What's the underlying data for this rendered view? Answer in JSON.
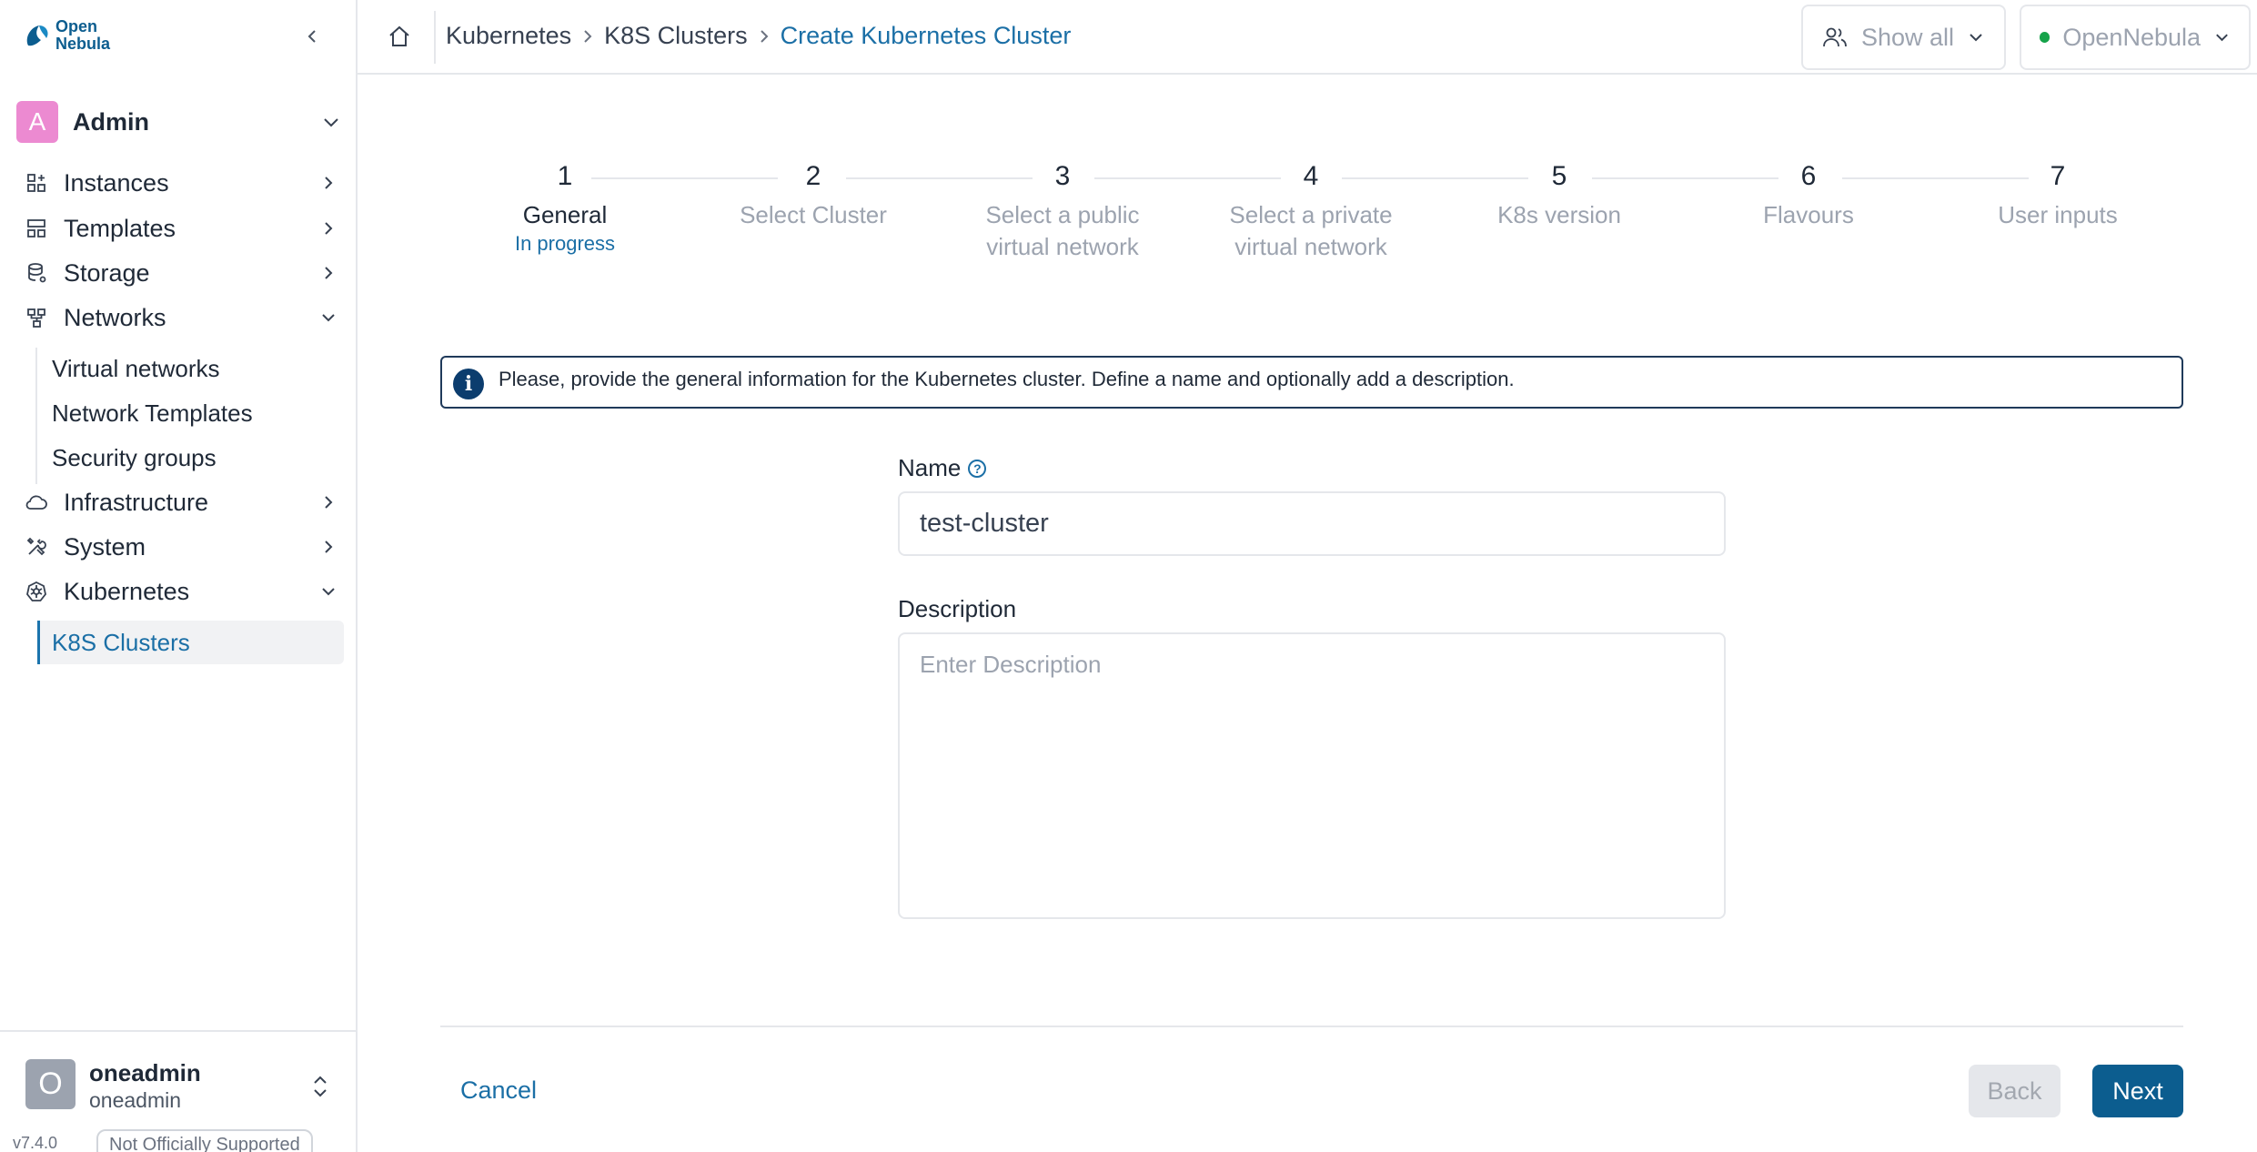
{
  "brand": {
    "logo_line1": "Open",
    "logo_line2": "Nebula",
    "accent": "#1b6fa6",
    "primary": "#0c5d8f"
  },
  "sidebar": {
    "group": {
      "avatar_letter": "A",
      "label": "Admin"
    },
    "items": [
      {
        "label": "Instances",
        "icon": "instances-icon",
        "expanded": false
      },
      {
        "label": "Templates",
        "icon": "templates-icon",
        "expanded": false
      },
      {
        "label": "Storage",
        "icon": "storage-icon",
        "expanded": false
      },
      {
        "label": "Networks",
        "icon": "networks-icon",
        "expanded": true,
        "children": [
          "Virtual networks",
          "Network Templates",
          "Security groups"
        ]
      },
      {
        "label": "Infrastructure",
        "icon": "cloud-icon",
        "expanded": false
      },
      {
        "label": "System",
        "icon": "tools-icon",
        "expanded": false
      },
      {
        "label": "Kubernetes",
        "icon": "kubernetes-icon",
        "expanded": true,
        "children": [
          "K8S Clusters"
        ]
      }
    ],
    "user": {
      "avatar_letter": "O",
      "name": "oneadmin",
      "group": "oneadmin"
    },
    "version": "v7.4.0",
    "support_badge": "Not Officially Supported"
  },
  "topbar": {
    "breadcrumb": [
      "Kubernetes",
      "K8S Clusters",
      "Create Kubernetes Cluster"
    ],
    "filter_label": "Show all",
    "zone_label": "OpenNebula",
    "zone_status_color": "#16a34a"
  },
  "stepper": {
    "steps": [
      {
        "num": "1",
        "label": "General",
        "status": "In progress"
      },
      {
        "num": "2",
        "label": "Select Cluster"
      },
      {
        "num": "3",
        "label_line1": "Select a public",
        "label_line2": "virtual network"
      },
      {
        "num": "4",
        "label_line1": "Select a private",
        "label_line2": "virtual network"
      },
      {
        "num": "5",
        "label": "K8s version"
      },
      {
        "num": "6",
        "label": "Flavours"
      },
      {
        "num": "7",
        "label": "User inputs"
      }
    ]
  },
  "info": {
    "text": "Please, provide the general information for the Kubernetes cluster. Define a name and optionally add a description."
  },
  "form": {
    "name_label": "Name",
    "name_value": "test-cluster",
    "description_label": "Description",
    "description_placeholder": "Enter Description"
  },
  "footer": {
    "cancel": "Cancel",
    "back": "Back",
    "next": "Next"
  }
}
